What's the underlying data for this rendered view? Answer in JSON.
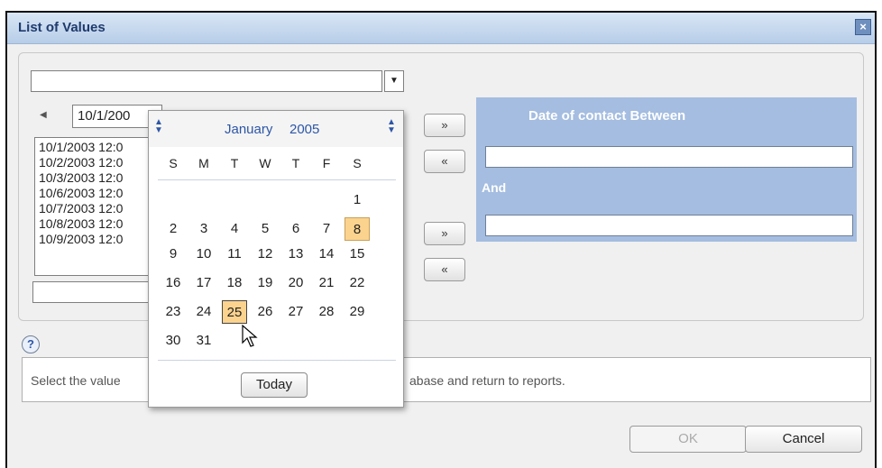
{
  "window": {
    "title": "List of Values"
  },
  "combo": {
    "value": ""
  },
  "date_input": {
    "value": "10/1/200"
  },
  "list_values": [
    "10/1/2003 12:0",
    "10/2/2003 12:0",
    "10/3/2003 12:0",
    "10/6/2003 12:0",
    "10/7/2003 12:0",
    "10/8/2003 12:0",
    "10/9/2003 12:0"
  ],
  "arrows": {
    "add": "»",
    "remove": "«"
  },
  "date_panel": {
    "title": "Date of contact Between",
    "and_label": "And",
    "from_value": "",
    "to_value": ""
  },
  "help": {
    "label": "?"
  },
  "description": {
    "left": "Select the value",
    "right": "abase and return to reports."
  },
  "buttons": {
    "ok": "OK",
    "cancel": "Cancel"
  },
  "calendar": {
    "month": "January",
    "year": "2005",
    "weekdays": [
      "S",
      "M",
      "T",
      "W",
      "T",
      "F",
      "S"
    ],
    "weeks": [
      [
        "",
        "",
        "",
        "",
        "",
        "",
        "1"
      ],
      [
        "2",
        "3",
        "4",
        "5",
        "6",
        "7",
        "8"
      ],
      [
        "9",
        "10",
        "11",
        "12",
        "13",
        "14",
        "15"
      ],
      [
        "16",
        "17",
        "18",
        "19",
        "20",
        "21",
        "22"
      ],
      [
        "23",
        "24",
        "25",
        "26",
        "27",
        "28",
        "29"
      ],
      [
        "30",
        "31",
        "",
        "",
        "",
        "",
        ""
      ]
    ],
    "today_day": "8",
    "selected_day": "25",
    "today_button": "Today",
    "highlight_color": "#fbd38e"
  }
}
